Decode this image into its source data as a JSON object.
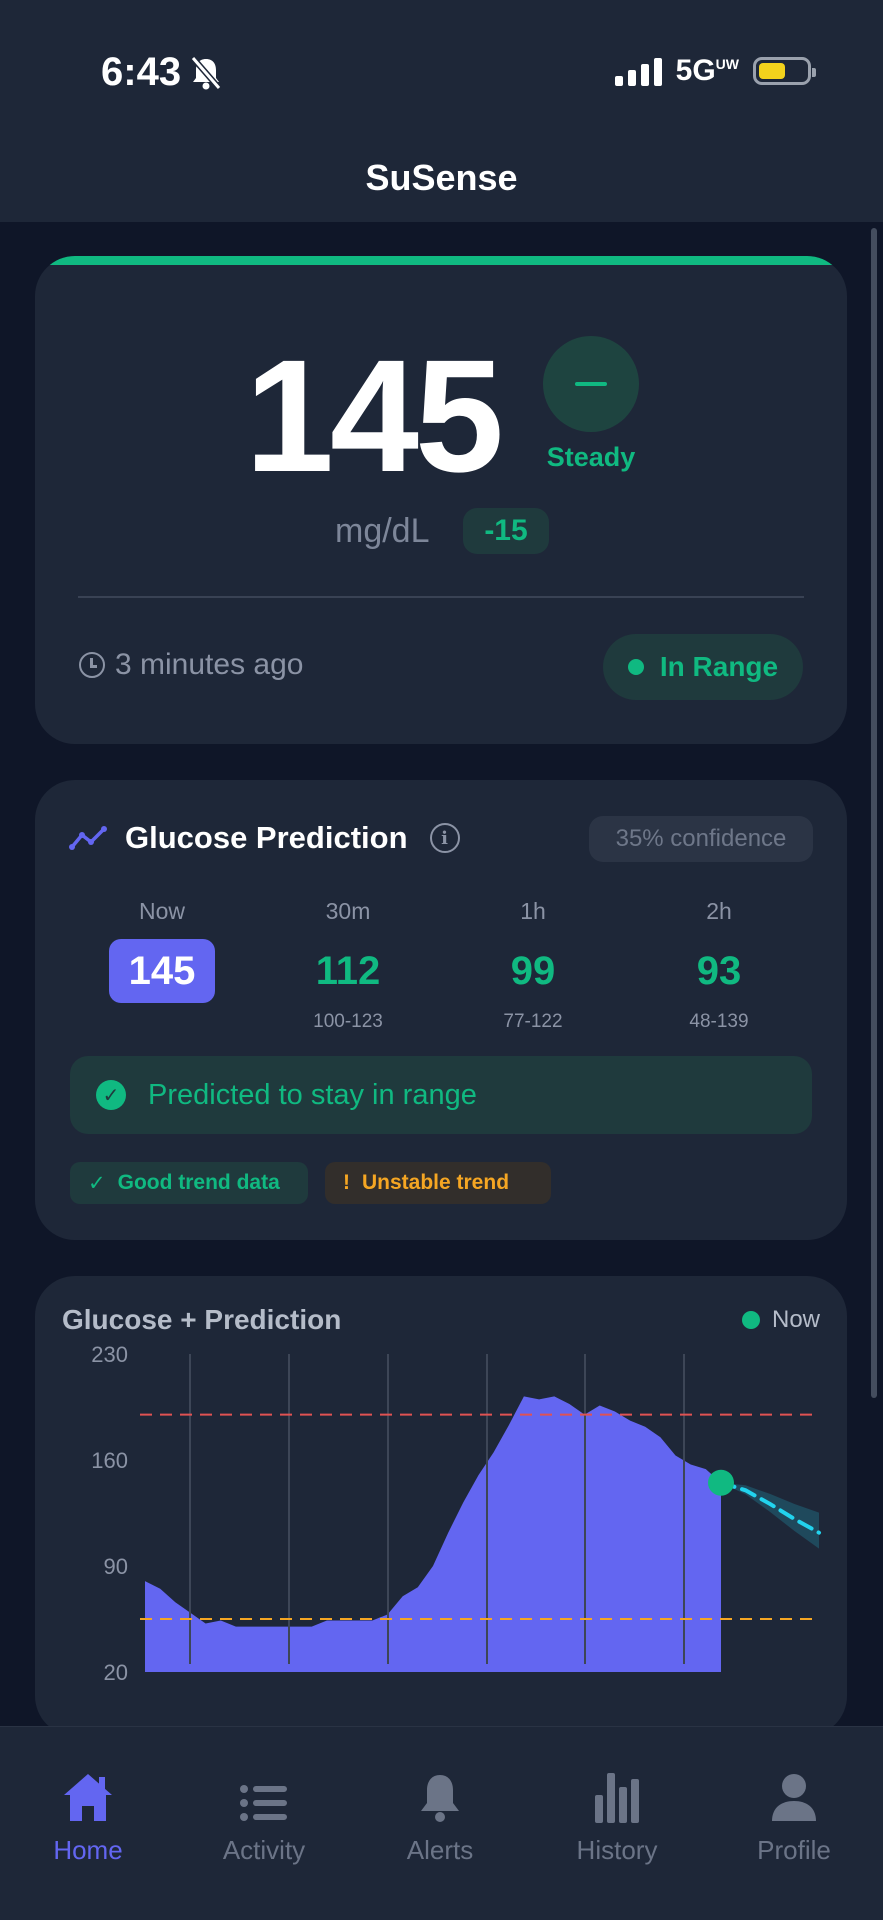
{
  "status_bar": {
    "time": "6:43",
    "network": "5G",
    "network_sup": "UW"
  },
  "app": {
    "title": "SuSense"
  },
  "reading": {
    "value": "145",
    "trend": "Steady",
    "unit": "mg/dL",
    "delta": "-15",
    "updated": "3 minutes ago",
    "status": "In Range"
  },
  "prediction": {
    "title": "Glucose Prediction",
    "confidence": "35% confidence",
    "horizons": [
      {
        "label": "Now",
        "value": "145",
        "range": ""
      },
      {
        "label": "30m",
        "value": "112",
        "range": "100-123"
      },
      {
        "label": "1h",
        "value": "99",
        "range": "77-122"
      },
      {
        "label": "2h",
        "value": "93",
        "range": "48-139"
      }
    ],
    "banner": "Predicted to stay in range",
    "tags": {
      "good": "Good trend data",
      "warn": "Unstable trend"
    }
  },
  "chart_data": {
    "type": "area",
    "title": "Glucose + Prediction",
    "legend": "Now",
    "yticks": [
      "230",
      "160",
      "90",
      "20"
    ],
    "ylim": [
      20,
      230
    ],
    "high_threshold": 190,
    "low_threshold": 55,
    "series": [
      {
        "values": [
          80,
          75,
          66,
          59,
          52,
          54,
          50,
          50,
          50,
          50,
          50,
          50,
          54,
          54,
          54,
          54,
          58,
          70,
          76,
          90,
          112,
          132,
          150,
          165,
          183,
          202,
          200,
          202,
          197,
          190,
          196,
          192,
          186,
          182,
          175,
          163,
          157,
          154,
          145
        ]
      },
      {
        "values": [
          145,
          140,
          131,
          121,
          112
        ]
      }
    ],
    "colors": {
      "history": "#6366f1",
      "prediction": "#22d3ee",
      "high": "#e05252",
      "low": "#f5a623",
      "now": "#10b981"
    }
  },
  "nav": {
    "items": [
      {
        "label": "Home",
        "active": true
      },
      {
        "label": "Activity",
        "active": false
      },
      {
        "label": "Alerts",
        "active": false
      },
      {
        "label": "History",
        "active": false
      },
      {
        "label": "Profile",
        "active": false
      }
    ]
  }
}
